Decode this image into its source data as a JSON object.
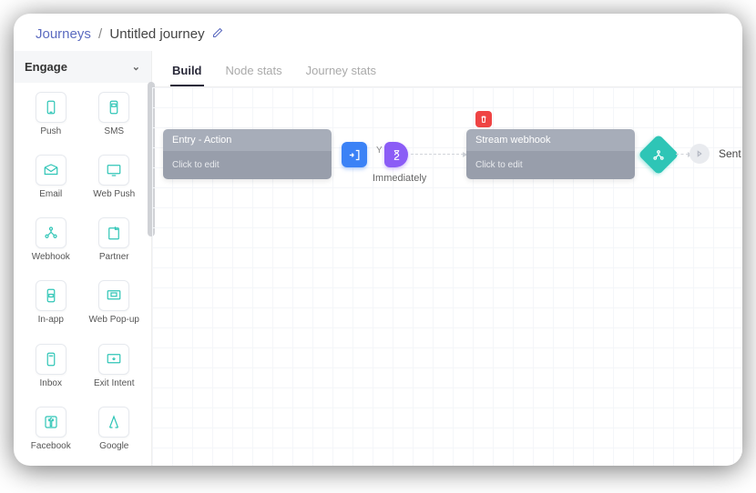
{
  "breadcrumb": {
    "parent": "Journeys",
    "current": "Untitled journey"
  },
  "sidebar": {
    "section_title": "Engage",
    "items": [
      {
        "label": "Push",
        "icon": "push-icon"
      },
      {
        "label": "SMS",
        "icon": "sms-icon"
      },
      {
        "label": "Email",
        "icon": "email-icon"
      },
      {
        "label": "Web Push",
        "icon": "web-push-icon"
      },
      {
        "label": "Webhook",
        "icon": "webhook-icon"
      },
      {
        "label": "Partner",
        "icon": "partner-icon"
      },
      {
        "label": "In-app",
        "icon": "inapp-icon"
      },
      {
        "label": "Web Pop-up",
        "icon": "web-popup-icon"
      },
      {
        "label": "Inbox",
        "icon": "inbox-icon"
      },
      {
        "label": "Exit Intent",
        "icon": "exit-intent-icon"
      },
      {
        "label": "Facebook",
        "icon": "facebook-icon"
      },
      {
        "label": "Google",
        "icon": "google-icon"
      }
    ]
  },
  "tabs": [
    {
      "label": "Build",
      "active": true
    },
    {
      "label": "Node stats",
      "active": false
    },
    {
      "label": "Journey stats",
      "active": false
    }
  ],
  "canvas": {
    "entry": {
      "title": "Entry - Action",
      "body": "Click to edit"
    },
    "wait": {
      "prefix": "Y",
      "label": "Immediately"
    },
    "stream": {
      "title": "Stream webhook",
      "body": "Click to edit"
    },
    "end": {
      "label": "Sent"
    }
  },
  "colors": {
    "accent": "#2ec5b6",
    "blue": "#3b82f6",
    "purple": "#8b5cf6",
    "danger": "#ef4444"
  }
}
